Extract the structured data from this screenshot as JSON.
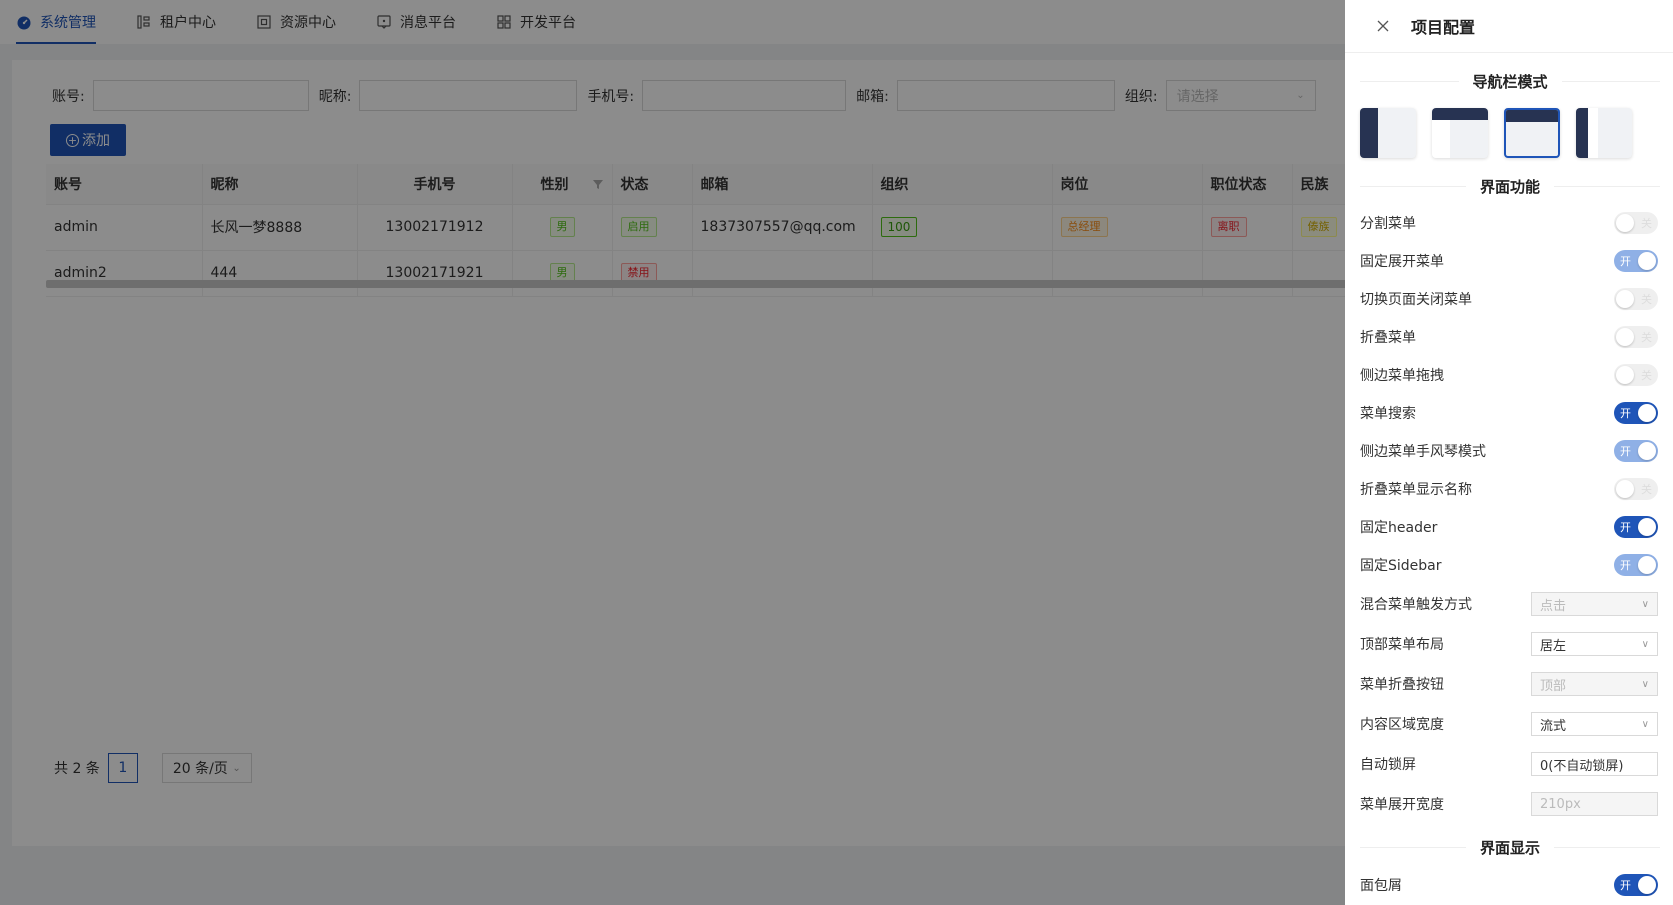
{
  "topnav": {
    "tabs": [
      {
        "label": "系统管理",
        "icon": "dashboard-icon"
      },
      {
        "label": "租户中心",
        "icon": "tenant-icon"
      },
      {
        "label": "资源中心",
        "icon": "resource-icon"
      },
      {
        "label": "消息平台",
        "icon": "message-icon"
      },
      {
        "label": "开发平台",
        "icon": "grid-icon"
      }
    ]
  },
  "filter": {
    "account": "账号:",
    "nickname": "昵称:",
    "phone": "手机号:",
    "email": "邮箱:",
    "org": "组织:",
    "org_placeholder": "请选择"
  },
  "add_button": "添加",
  "table": {
    "headers": [
      "账号",
      "昵称",
      "手机号",
      "性别",
      "状态",
      "邮箱",
      "组织",
      "岗位",
      "职位状态",
      "民族"
    ],
    "rows": [
      {
        "account": "admin",
        "nickname": "长风一梦8888",
        "phone": "13002171912",
        "gender": "男",
        "status": "启用",
        "email": "1837307557@qq.com",
        "org": "100",
        "post": "总经理",
        "post_status": "离职",
        "nation": "傣族"
      },
      {
        "account": "admin2",
        "nickname": "444",
        "phone": "13002171921",
        "gender": "男",
        "status": "禁用",
        "email": "",
        "org": "",
        "post": "",
        "post_status": "",
        "nation": ""
      }
    ]
  },
  "pager": {
    "total": "共 2 条",
    "page": "1",
    "size": "20 条/页"
  },
  "drawer": {
    "title": "项目配置",
    "section_nav": "导航栏模式",
    "section_func": "界面功能",
    "section_display": "界面显示",
    "switch_on": "开",
    "switch_off": "关",
    "toggles": [
      {
        "label": "分割菜单",
        "state": "off"
      },
      {
        "label": "固定展开菜单",
        "state": "on-dim"
      },
      {
        "label": "切换页面关闭菜单",
        "state": "off"
      },
      {
        "label": "折叠菜单",
        "state": "off"
      },
      {
        "label": "侧边菜单拖拽",
        "state": "off"
      },
      {
        "label": "菜单搜索",
        "state": "on"
      },
      {
        "label": "侧边菜单手风琴模式",
        "state": "on-dim"
      },
      {
        "label": "折叠菜单显示名称",
        "state": "off"
      },
      {
        "label": "固定header",
        "state": "on"
      },
      {
        "label": "固定Sidebar",
        "state": "on-dim"
      }
    ],
    "selects": [
      {
        "label": "混合菜单触发方式",
        "value": "点击",
        "disabled": true
      },
      {
        "label": "顶部菜单布局",
        "value": "居左",
        "disabled": false
      },
      {
        "label": "菜单折叠按钮",
        "value": "顶部",
        "disabled": true
      },
      {
        "label": "内容区域宽度",
        "value": "流式",
        "disabled": false
      }
    ],
    "inputs": [
      {
        "label": "自动锁屏",
        "value": "0(不自动锁屏)",
        "disabled": false
      },
      {
        "label": "菜单展开宽度",
        "value": "210px",
        "disabled": true
      }
    ],
    "display_toggles": [
      {
        "label": "面包屑",
        "state": "on"
      }
    ]
  },
  "colors": {
    "primary": "#1f55b8",
    "dark_nav": "#273352"
  }
}
